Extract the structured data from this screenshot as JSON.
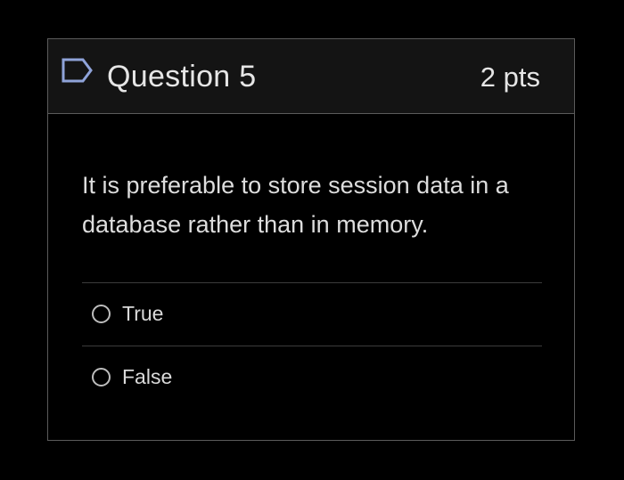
{
  "question": {
    "title": "Question 5",
    "points": "2 pts",
    "text": "It is preferable to store session data in a database rather than in memory.",
    "flag_icon": "flag-outline-icon"
  },
  "answers": [
    {
      "label": "True",
      "selected": false
    },
    {
      "label": "False",
      "selected": false
    }
  ],
  "colors": {
    "background": "#000000",
    "header_background": "#141414",
    "border": "#5b5b5b",
    "flag_icon": "#8fa3d9",
    "text": "#e6e6e6"
  }
}
